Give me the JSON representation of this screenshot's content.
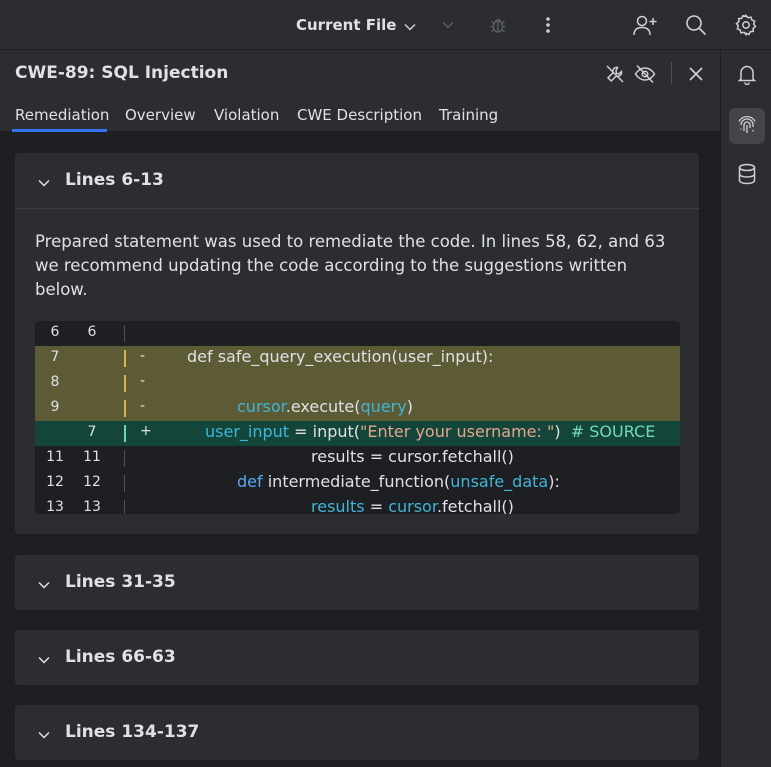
{
  "toolbar": {
    "run_config": "Current File",
    "icons": [
      "chevron-down-icon",
      "chevron-down-icon",
      "debug-bug-icon",
      "more-vertical-icon",
      "add-user-icon",
      "search-icon",
      "settings-gear-icon"
    ]
  },
  "right_strip": {
    "items": [
      {
        "icon": "bell-icon",
        "active": false
      },
      {
        "icon": "fingerprint-icon",
        "active": true
      },
      {
        "icon": "database-icon",
        "active": false
      }
    ]
  },
  "panel": {
    "title": "CWE-89: SQL Injection",
    "header_icons": [
      "wrench-off-icon",
      "eye-off-icon",
      "close-icon"
    ],
    "tabs": [
      "Remediation",
      "Overview",
      "Violation",
      "CWE Description",
      "Training"
    ],
    "active_tab": "Remediation"
  },
  "sections": [
    {
      "title": "Lines 6-13",
      "expanded": true,
      "description": "Prepared statement was used to remediate the code. In lines 58, 62, and 63 we recommend updating the code according to the suggestions written below.",
      "code_rows": [
        {
          "old": "6",
          "new": "6",
          "marker": "",
          "type": "context",
          "segments": [
            {
              "text": "",
              "cls": ""
            }
          ]
        },
        {
          "old": "7",
          "new": "",
          "marker": "-",
          "type": "del",
          "segments": [
            {
              "text": "def safe_query_execution(user_input):",
              "cls": ""
            }
          ]
        },
        {
          "old": "8",
          "new": "",
          "marker": "-",
          "type": "del",
          "segments": [
            {
              "text": "",
              "cls": ""
            }
          ]
        },
        {
          "old": "9",
          "new": "",
          "marker": "-",
          "type": "del",
          "segments": [
            {
              "text": "cursor",
              "cls": "id"
            },
            {
              "text": ".execute(",
              "cls": ""
            },
            {
              "text": "query",
              "cls": "id"
            },
            {
              "text": ")",
              "cls": ""
            }
          ]
        },
        {
          "old": "",
          "new": "7",
          "marker": "+",
          "type": "add",
          "segments": [
            {
              "text": "user_input",
              "cls": "id"
            },
            {
              "text": " = input(",
              "cls": ""
            },
            {
              "text": "\"Enter your username: \"",
              "cls": "str"
            },
            {
              "text": ")  ",
              "cls": ""
            },
            {
              "text": "# SOURCE",
              "cls": "cmt"
            }
          ]
        },
        {
          "old": "11",
          "new": "11",
          "marker": "",
          "type": "context",
          "segments": [
            {
              "text": "results = cursor.fetchall()",
              "cls": ""
            }
          ]
        },
        {
          "old": "12",
          "new": "12",
          "marker": "",
          "type": "context",
          "segments": [
            {
              "text": "def",
              "cls": "kw"
            },
            {
              "text": " intermediate_function(",
              "cls": ""
            },
            {
              "text": "unsafe_data",
              "cls": "id"
            },
            {
              "text": "):",
              "cls": ""
            }
          ]
        },
        {
          "old": "13",
          "new": "13",
          "marker": "",
          "type": "context",
          "segments": [
            {
              "text": "results",
              "cls": "id"
            },
            {
              "text": " = ",
              "cls": ""
            },
            {
              "text": "cursor",
              "cls": "id"
            },
            {
              "text": ".fetchall()",
              "cls": ""
            }
          ]
        }
      ]
    },
    {
      "title": "Lines 31-35",
      "expanded": false
    },
    {
      "title": "Lines 66-63",
      "expanded": false
    },
    {
      "title": "Lines 134-137",
      "expanded": false
    }
  ]
}
